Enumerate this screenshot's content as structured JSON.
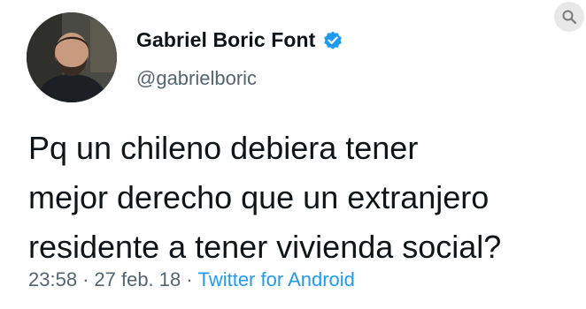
{
  "user": {
    "display_name": "Gabriel Boric Font",
    "handle": "@gabrielboric",
    "verified": true,
    "avatar_icon": "profile-photo"
  },
  "tweet": {
    "text": "Pq un chileno debiera tener\nmejor derecho que un extranjero\nresidente a tener vivienda social?",
    "time": "23:58",
    "separator": "·",
    "date": "27 feb. 18",
    "source": "Twitter for Android"
  },
  "overlay": {
    "icon": "image-search-icon"
  },
  "colors": {
    "text": "#0f1419",
    "secondary": "#536471",
    "link": "#1d9bf0",
    "verified": "#1d9bf0"
  }
}
